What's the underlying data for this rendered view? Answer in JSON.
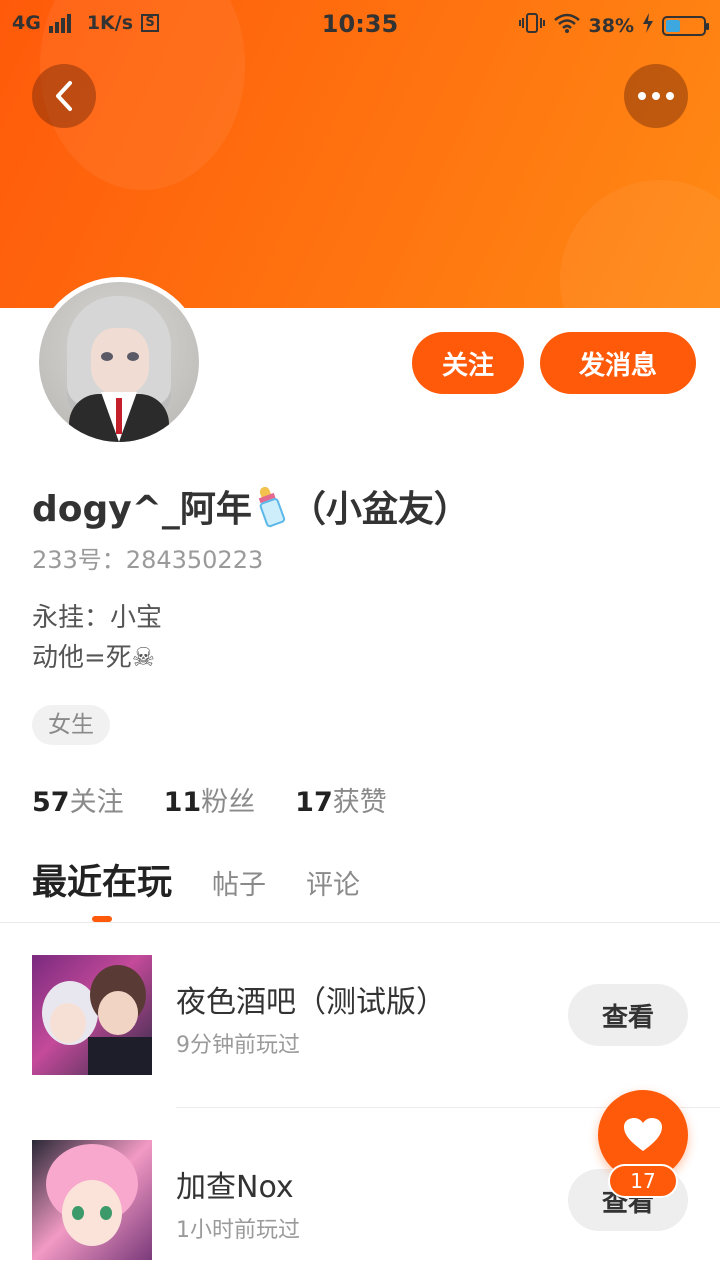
{
  "statusbar": {
    "network": "4G",
    "speed": "1K/s",
    "s_badge": "S",
    "time": "10:35",
    "battery": "38%",
    "battery_level": 0.38
  },
  "icons": {
    "back": "chevron-left-icon",
    "more": "more-dots-icon",
    "heart": "heart-icon",
    "bottle": "baby-bottle-icon"
  },
  "colors": {
    "accent": "#ff5a0a",
    "header_gradient_start": "#ff5a0a",
    "header_gradient_end": "#ff8a14"
  },
  "profile": {
    "name_part1": "dogy^_阿年",
    "name_part2": "（小盆友）",
    "uid": "233号：284350223",
    "bio_line1": "永挂：小宝",
    "bio_line2": "动他=死☠",
    "gender": "女生",
    "follow_label": "关注",
    "message_label": "发消息"
  },
  "stats": [
    {
      "value": "57",
      "label": "关注"
    },
    {
      "value": "11",
      "label": "粉丝"
    },
    {
      "value": "17",
      "label": "获赞"
    }
  ],
  "tabs": [
    {
      "label": "最近在玩",
      "active": true
    },
    {
      "label": "帖子",
      "active": false
    },
    {
      "label": "评论",
      "active": false
    }
  ],
  "games": [
    {
      "title": "夜色酒吧（测试版）",
      "time": "9分钟前玩过",
      "action": "查看"
    },
    {
      "title": "加查Nox",
      "time": "1小时前玩过",
      "action": "查看"
    }
  ],
  "like": {
    "count": "17"
  }
}
